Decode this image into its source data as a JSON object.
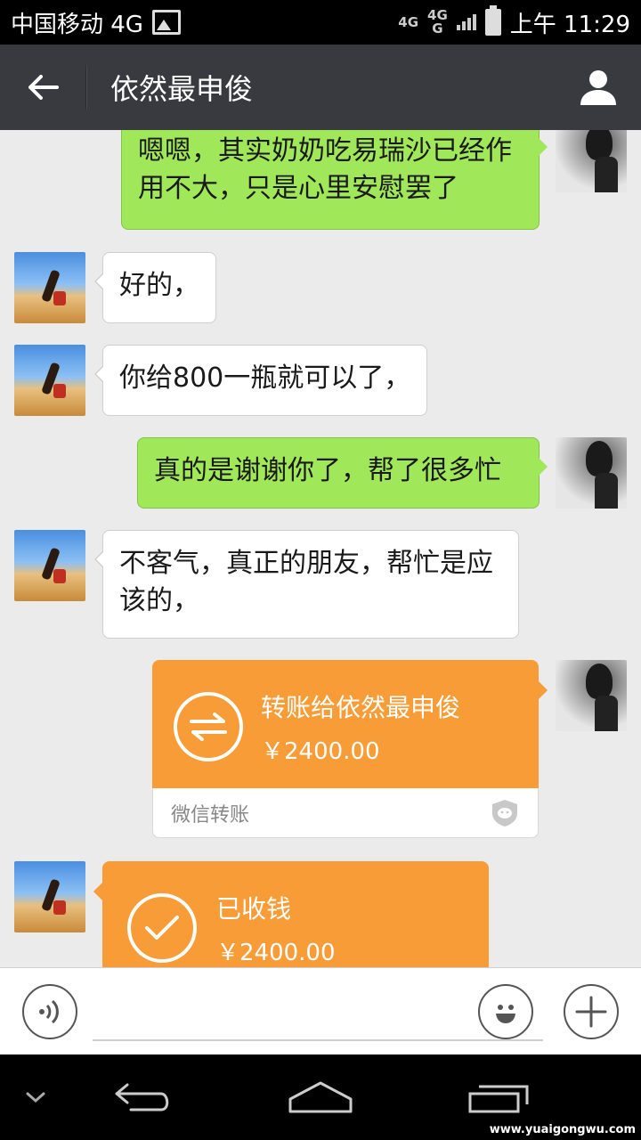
{
  "status_bar": {
    "carrier": "中国移动 4G",
    "network_1": "4G",
    "network_2_top": "4G",
    "network_2_bottom": "G",
    "time": "上午 11:29"
  },
  "header": {
    "title": "依然最申俊",
    "back_icon": "back-arrow-icon",
    "profile_icon": "person-icon"
  },
  "messages": [
    {
      "side": "out",
      "text": "嗯嗯，其实奶奶吃易瑞沙已经作用不大，只是心里安慰罢了"
    },
    {
      "side": "in",
      "text": "好的，"
    },
    {
      "side": "in",
      "text": "你给800一瓶就可以了，"
    },
    {
      "side": "out",
      "text": "真的是谢谢你了，帮了很多忙"
    },
    {
      "side": "in",
      "text": "不客气，真正的朋友，帮忙是应该的，"
    }
  ],
  "transfer_sent": {
    "title": "转账给依然最申俊",
    "amount": "￥2400.00",
    "footer": "微信转账",
    "color": "#f79c37"
  },
  "transfer_received": {
    "title": "已收钱",
    "amount": "￥2400.00"
  },
  "input_bar": {
    "voice_icon": "voice-icon",
    "emoji_icon": "emoji-icon",
    "plus_icon": "plus-icon",
    "placeholder": ""
  },
  "nav_bar": {
    "watermark": "www.yuaigongwu.com"
  },
  "colors": {
    "status_bar": "#000000",
    "title_bar": "#393a3f",
    "chat_bg": "#ebebeb",
    "bubble_out": "#a0e75a",
    "bubble_in": "#ffffff",
    "transfer": "#f79c37"
  }
}
